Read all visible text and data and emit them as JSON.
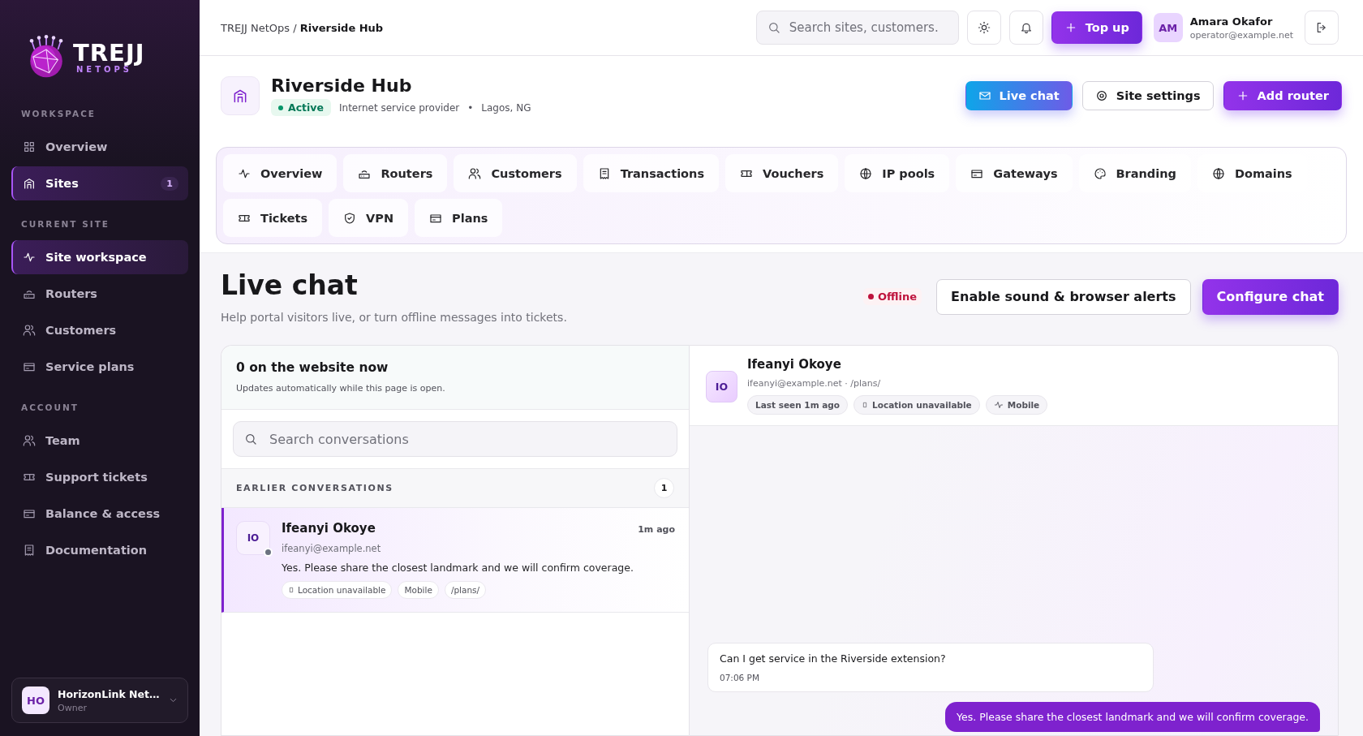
{
  "sidebar": {
    "brand": "TREJJ",
    "brand_sub": "NETOPS",
    "sections": [
      {
        "title": "WORKSPACE",
        "items": [
          {
            "label": "Overview",
            "kind": "grid",
            "selected": false
          },
          {
            "label": "Sites",
            "kind": "building",
            "selected": true,
            "badge": "1"
          }
        ]
      },
      {
        "title": "CURRENT SITE",
        "items": [
          {
            "label": "Site workspace",
            "kind": "activity",
            "selected": true
          },
          {
            "label": "Routers",
            "kind": "router",
            "selected": false
          },
          {
            "label": "Customers",
            "kind": "users",
            "selected": false
          },
          {
            "label": "Service plans",
            "kind": "card",
            "selected": false
          }
        ]
      },
      {
        "title": "ACCOUNT",
        "items": [
          {
            "label": "Team",
            "kind": "users",
            "selected": false
          },
          {
            "label": "Support tickets",
            "kind": "ticket",
            "selected": false
          },
          {
            "label": "Balance & access",
            "kind": "card",
            "selected": false
          },
          {
            "label": "Documentation",
            "kind": "receipt",
            "selected": false
          }
        ]
      }
    ],
    "account": {
      "initials": "HO",
      "name": "HorizonLink Net…",
      "role": "Owner"
    }
  },
  "topbar": {
    "breadcrumb": {
      "parent": "TREJJ NetOps",
      "separator": "/",
      "current": "Riverside Hub"
    },
    "search": {
      "placeholder": "Search sites, customers."
    },
    "top_up": "Top up",
    "user": {
      "initials": "AM",
      "name": "Amara Okafor",
      "email": "operator@example.net"
    }
  },
  "site": {
    "name": "Riverside Hub",
    "status": "Active",
    "type": "Internet service provider",
    "separator": "•",
    "location": "Lagos, NG",
    "buttons": [
      {
        "label": "Live chat",
        "kind": "gradient"
      },
      {
        "label": "Site settings",
        "kind": "outline"
      },
      {
        "label": "Add router",
        "kind": "primary"
      }
    ]
  },
  "tabs": [
    {
      "label": "Overview",
      "kind": "activity",
      "selected": false
    },
    {
      "label": "Routers",
      "kind": "router",
      "selected": false
    },
    {
      "label": "Customers",
      "kind": "users",
      "selected": false
    },
    {
      "label": "Transactions",
      "kind": "receipt",
      "selected": false
    },
    {
      "label": "Vouchers",
      "kind": "ticket",
      "selected": false
    },
    {
      "label": "IP pools",
      "kind": "globe",
      "selected": false
    },
    {
      "label": "Gateways",
      "kind": "card",
      "selected": false
    },
    {
      "label": "Branding",
      "kind": "palette",
      "selected": false
    },
    {
      "label": "Domains",
      "kind": "globe",
      "selected": false
    },
    {
      "label": "Tickets",
      "kind": "ticket",
      "selected": false
    },
    {
      "label": "VPN",
      "kind": "shield",
      "selected": false
    },
    {
      "label": "Plans",
      "kind": "card",
      "selected": false
    }
  ],
  "page": {
    "title": "Live chat",
    "subtitle": "Help portal visitors live, or turn offline messages into tickets.",
    "status": "Offline",
    "online": false,
    "buttons": [
      {
        "label": "Enable sound & browser alerts",
        "kind": "outline"
      },
      {
        "label": "Configure chat",
        "kind": "primary"
      }
    ]
  },
  "visitors": {
    "title": "0 on the website now",
    "note": "Updates automatically while this page is open."
  },
  "conversation_search": {
    "placeholder": "Search conversations"
  },
  "earlier": {
    "title": "EARLIER CONVERSATIONS",
    "count": "1"
  },
  "conversations": [
    {
      "initials": "IO",
      "name": "Ifeanyi Okoye",
      "email": "ifeanyi@example.net",
      "time": "1m ago",
      "message": "Yes. Please share the closest landmark and we will confirm coverage.",
      "online": false,
      "selected": true,
      "tags": [
        {
          "label": "Location unavailable",
          "kind": "location"
        },
        {
          "label": "Mobile",
          "kind": "plain"
        },
        {
          "label": "/plans/",
          "kind": "plain"
        }
      ]
    }
  ],
  "chat": {
    "initials": "IO",
    "name": "Ifeanyi Okoye",
    "meta": "ifeanyi@example.net · /plans/",
    "chips": [
      {
        "label": "Last seen 1m ago",
        "kind": "plain"
      },
      {
        "label": "Location unavailable",
        "kind": "location"
      },
      {
        "label": "Mobile",
        "kind": "activity"
      }
    ],
    "messages": [
      {
        "kind": "visitor",
        "text": "Can I get service in the Riverside extension?",
        "time": "07:06 PM"
      },
      {
        "kind": "agent",
        "text": "Yes. Please share the closest landmark and we will confirm coverage."
      }
    ]
  }
}
